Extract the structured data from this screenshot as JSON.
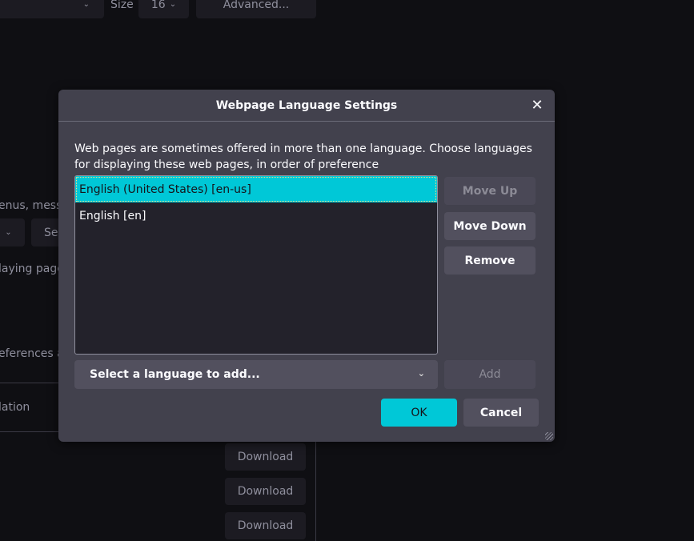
{
  "background": {
    "size_label": "Size",
    "size_value": "16",
    "advanced_button": "Advanced...",
    "fragment_menus": "enus, messa",
    "fragment_set_button": "Se",
    "fragment_displaying": "laying page",
    "fragment_preferences": "eferences a",
    "fragment_translation": "lation",
    "download_buttons": [
      "Download",
      "Download",
      "Download"
    ]
  },
  "dialog": {
    "title": "Webpage Language Settings",
    "description": "Web pages are sometimes offered in more than one language. Choose languages for displaying these web pages, in order of preference",
    "languages": [
      {
        "label": "English (United States) [en-us]",
        "selected": true
      },
      {
        "label": "English [en]",
        "selected": false
      }
    ],
    "move_up": "Move Up",
    "move_down": "Move Down",
    "remove": "Remove",
    "select_placeholder": "Select a language to add...",
    "add": "Add",
    "ok": "OK",
    "cancel": "Cancel"
  },
  "colors": {
    "accent": "#00c8d7",
    "dialog_bg": "#42414d",
    "page_bg": "#0f0f13"
  }
}
